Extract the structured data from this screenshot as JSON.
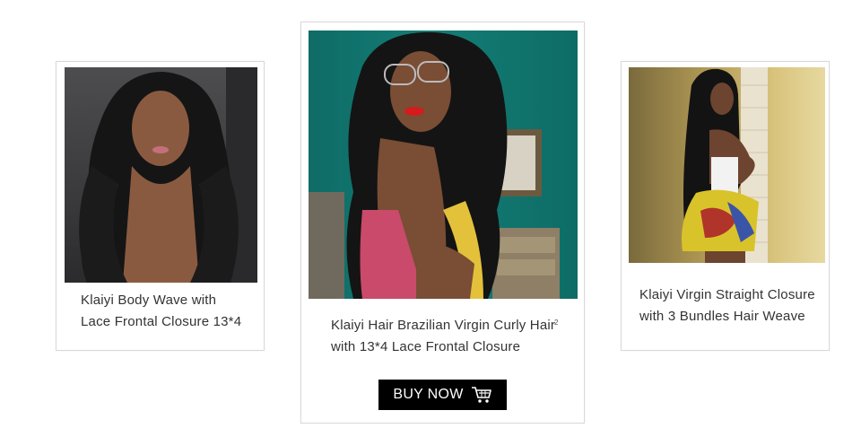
{
  "products": [
    {
      "title_line1": "Klaiyi Body Wave with",
      "title_line2": "Lace Frontal Closure 13*4",
      "image_icon": "model-body-wave-photo"
    },
    {
      "title_line1": "Klaiyi Hair Brazilian Virgin Curly Hair",
      "title_line2": "with 13*4 Lace Frontal Closure",
      "note": "2",
      "image_icon": "model-curly-hair-photo",
      "button_label": "BUY NOW",
      "button_icon": "cart-icon"
    },
    {
      "title_line1": "Klaiyi Virgin Straight Closure",
      "title_line2": "with 3 Bundles Hair Weave",
      "image_icon": "model-straight-hair-photo"
    }
  ],
  "colors": {
    "button_bg": "#000000",
    "button_text": "#ffffff",
    "card_border": "#d9d9d9"
  }
}
